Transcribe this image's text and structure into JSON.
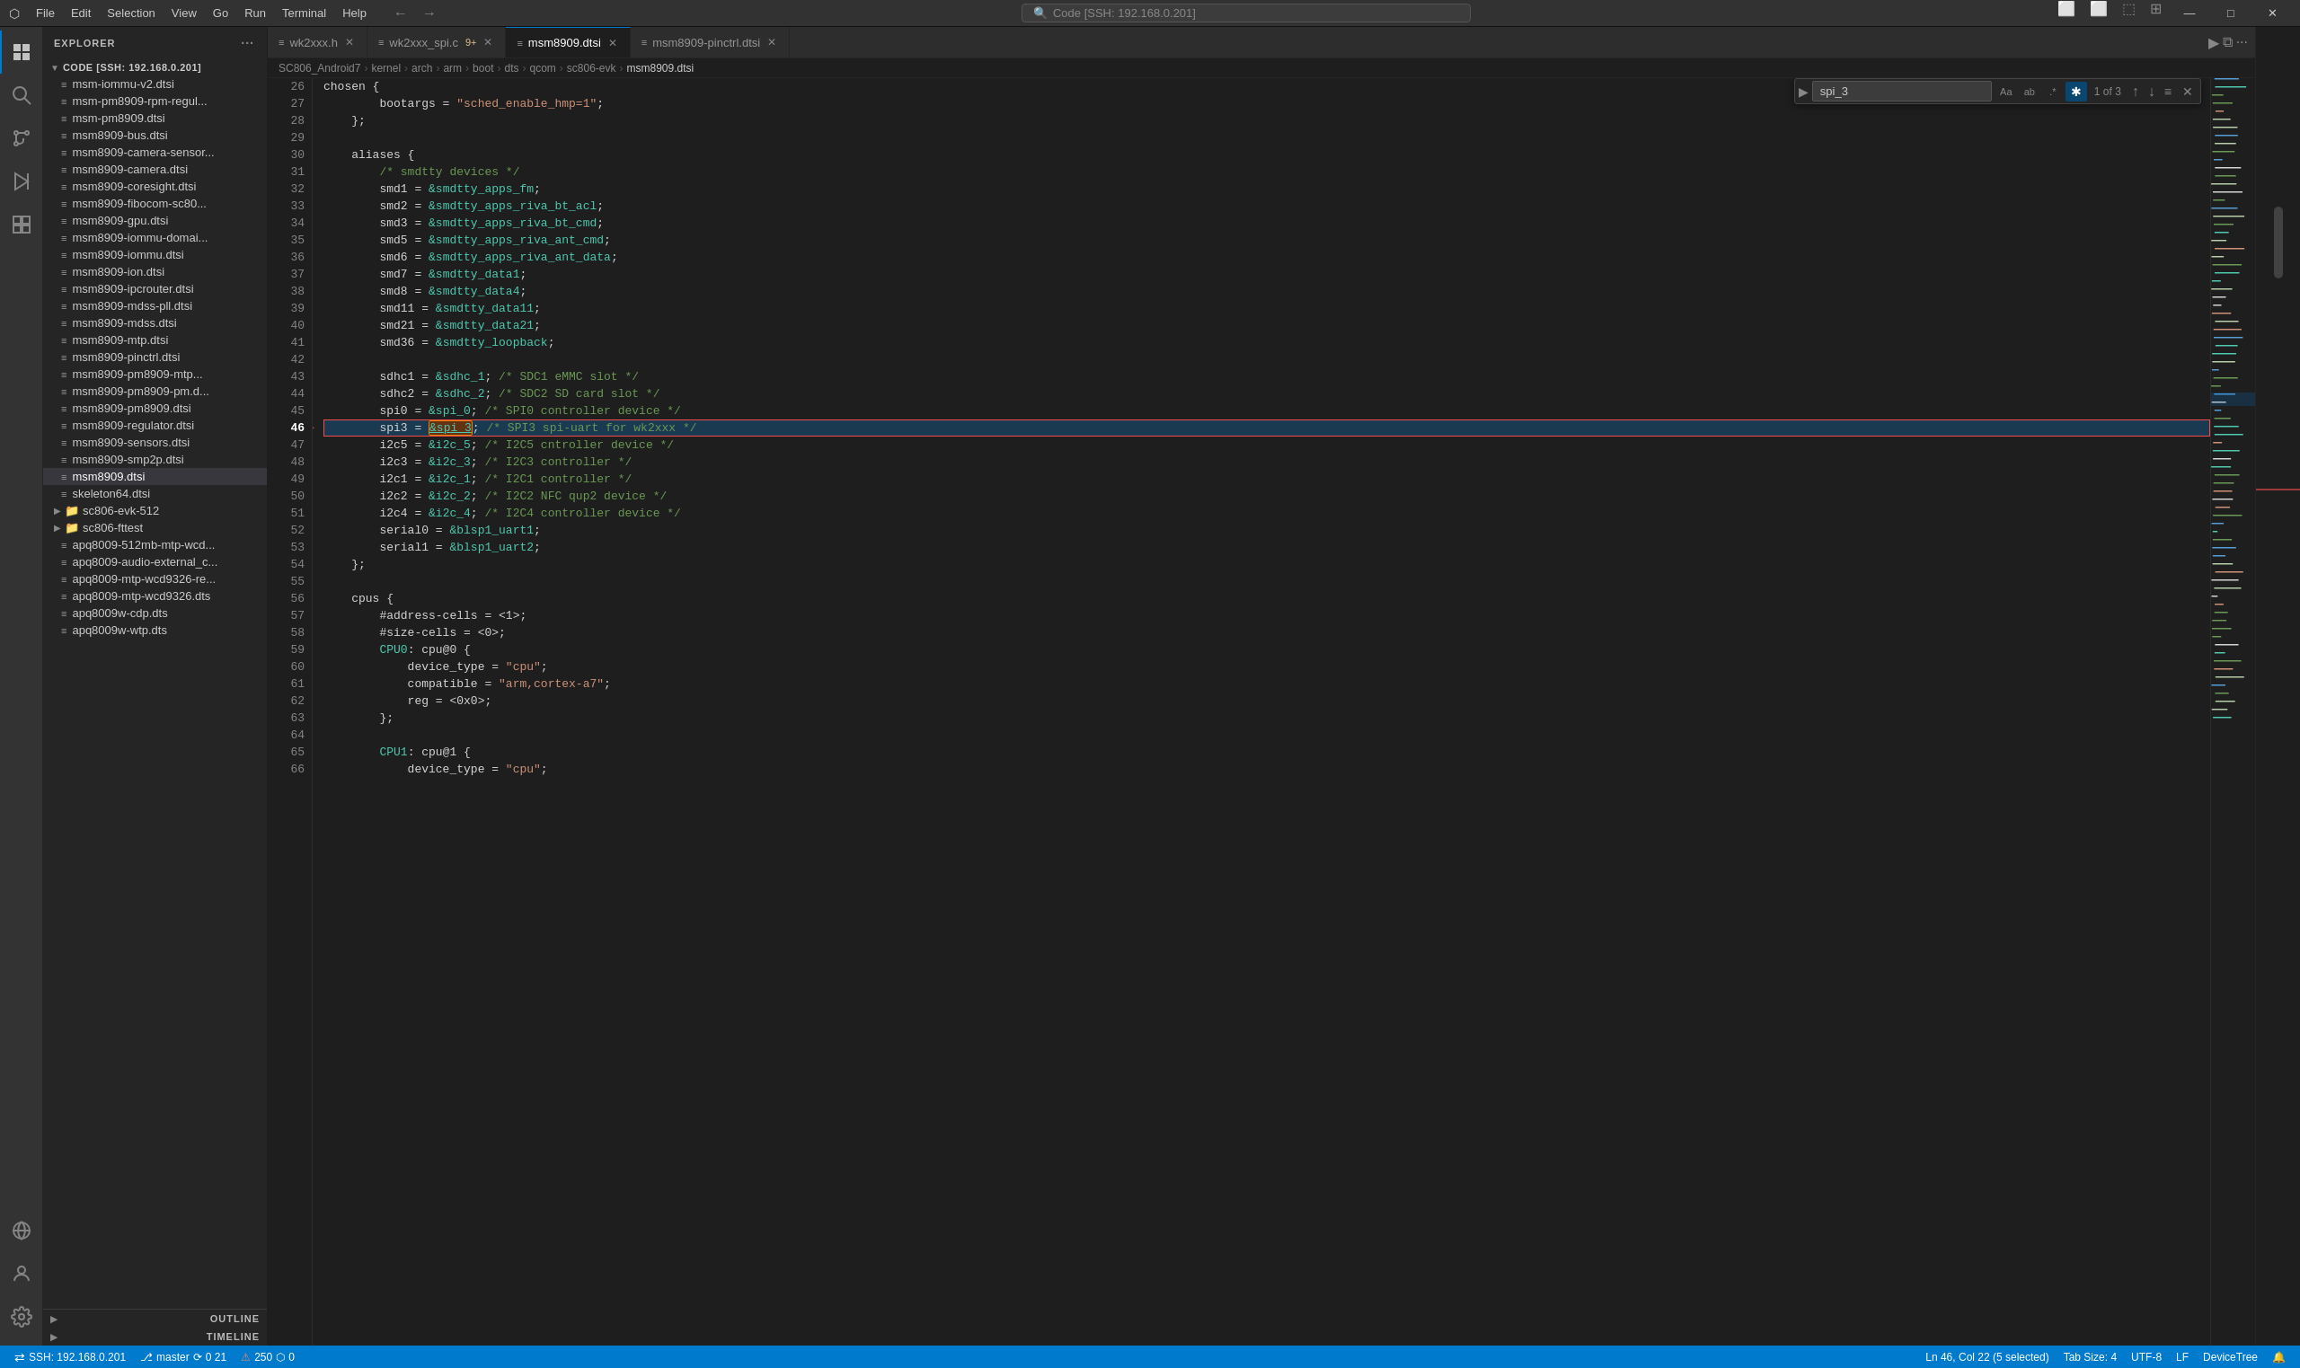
{
  "titlebar": {
    "icon": "⬡",
    "menu": [
      "File",
      "Edit",
      "Selection",
      "View",
      "Go",
      "Run",
      "Terminal",
      "Help"
    ],
    "search_placeholder": "Code [SSH: 192.168.0.201]",
    "window_controls": [
      "─",
      "□",
      "✕"
    ]
  },
  "sidebar": {
    "title": "EXPLORER",
    "more_icon": "···",
    "root": {
      "label": "CODE [SSH: 192.168.0.201]",
      "expanded": true
    },
    "files": [
      "msm-iommu-v2.dtsi",
      "msm-pm8909-rpm-regul...",
      "msm-pm8909.dtsi",
      "msm8909-bus.dtsi",
      "msm8909-camera-sensor...",
      "msm8909-camera.dtsi",
      "msm8909-coresight.dtsi",
      "msm8909-fibocom-sc80...",
      "msm8909-gpu.dtsi",
      "msm8909-iommu-domai...",
      "msm8909-iommu.dtsi",
      "msm8909-ion.dtsi",
      "msm8909-ipcrouter.dtsi",
      "msm8909-mdss-pll.dtsi",
      "msm8909-mdss.dtsi",
      "msm8909-mtp.dtsi",
      "msm8909-pinctrl.dtsi",
      "msm8909-pm8909-mtp...",
      "msm8909-pm8909-pm.d...",
      "msm8909-pm8909.dtsi",
      "msm8909-regulator.dtsi",
      "msm8909-sensors.dtsi",
      "msm8909-smp2p.dtsi",
      "msm8909.dtsi",
      "skeleton64.dtsi"
    ],
    "folders": [
      "sc806-evk-512",
      "sc806-fttest"
    ],
    "other_files": [
      "apq8009-512mb-mtp-wcd...",
      "apq8009-audio-external_c...",
      "apq8009-mtp-wcd9326-re...",
      "apq8009-mtp-wcd9326.dts",
      "apq8009w-cdp.dts",
      "apq8009w-wtp.dts"
    ],
    "panels": {
      "outline": "OUTLINE",
      "timeline": "TIMELINE"
    }
  },
  "tabs": [
    {
      "label": "wk2xxx.h",
      "active": false,
      "modified": false,
      "icon": "≡"
    },
    {
      "label": "wk2xxx_spi.c",
      "active": false,
      "modified": true,
      "count": "9+",
      "icon": "≡"
    },
    {
      "label": "msm8909.dtsi",
      "active": true,
      "modified": false,
      "icon": "≡"
    },
    {
      "label": "msm8909-pinctrl.dtsi",
      "active": false,
      "modified": false,
      "icon": "≡"
    }
  ],
  "breadcrumb": [
    "SC806_Android7",
    "kernel",
    "arch",
    "arm",
    "boot",
    "dts",
    "qcom",
    "sc806-evk",
    "msm8909.dtsi"
  ],
  "find_widget": {
    "search_term": "spi_3",
    "count": "1 of 3",
    "options": [
      "Aa",
      "ab",
      ".*"
    ]
  },
  "code": {
    "lines": [
      {
        "num": 26,
        "content": "chosen {",
        "type": "plain"
      },
      {
        "num": 27,
        "content": "\t\tbootargs = \"sched_enable_hmp=1\";",
        "type": "str"
      },
      {
        "num": 28,
        "content": "\t};",
        "type": "plain"
      },
      {
        "num": 29,
        "content": "",
        "type": "plain"
      },
      {
        "num": 30,
        "content": "\taliases {",
        "type": "plain"
      },
      {
        "num": 31,
        "content": "\t\t/* smdtty devices */",
        "type": "comment"
      },
      {
        "num": 32,
        "content": "\t\tsmd1 = &smdtty_apps_fm;",
        "type": "ref"
      },
      {
        "num": 33,
        "content": "\t\tsmd2 = &smdtty_apps_riva_bt_acl;",
        "type": "ref"
      },
      {
        "num": 34,
        "content": "\t\tsmd3 = &smdtty_apps_riva_bt_cmd;",
        "type": "ref"
      },
      {
        "num": 35,
        "content": "\t\tsmd5 = &smdtty_apps_riva_ant_cmd;",
        "type": "ref"
      },
      {
        "num": 36,
        "content": "\t\tsmd6 = &smdtty_apps_riva_ant_data;",
        "type": "ref"
      },
      {
        "num": 37,
        "content": "\t\tsmd7 = &smdtty_data1;",
        "type": "ref"
      },
      {
        "num": 38,
        "content": "\t\tsmd8 = &smdtty_data4;",
        "type": "ref"
      },
      {
        "num": 39,
        "content": "\t\tsmd11 = &smdtty_data11;",
        "type": "ref"
      },
      {
        "num": 40,
        "content": "\t\tsmd21 = &smdtty_data21;",
        "type": "ref"
      },
      {
        "num": 41,
        "content": "\t\tsmd36 = &smdtty_loopback;",
        "type": "ref"
      },
      {
        "num": 42,
        "content": "",
        "type": "plain"
      },
      {
        "num": 43,
        "content": "\t\tsdhc1 = &sdhc_1; /* SDC1 eMMC slot */",
        "type": "ref_comment"
      },
      {
        "num": 44,
        "content": "\t\tsdhc2 = &sdhc_2; /* SDC2 SD card slot */",
        "type": "ref_comment"
      },
      {
        "num": 45,
        "content": "\t\tspi0 = &spi_0; /* SPI0 controller device */",
        "type": "ref_comment"
      },
      {
        "num": 46,
        "content": "\t\tspi3 = &spi_3; /* SPI3 spi-uart for wk2xxx */",
        "type": "highlighted"
      },
      {
        "num": 47,
        "content": "\t\ti2c5 = &i2c_5; /* I2C5 cntroller device */",
        "type": "ref_comment"
      },
      {
        "num": 48,
        "content": "\t\ti2c3 = &i2c_3; /* I2C3 controller */",
        "type": "ref_comment"
      },
      {
        "num": 49,
        "content": "\t\ti2c1 = &i2c_1; /* I2C1 controller */",
        "type": "ref_comment"
      },
      {
        "num": 50,
        "content": "\t\ti2c2 = &i2c_2; /* I2C2 NFC qup2 device */",
        "type": "ref_comment"
      },
      {
        "num": 51,
        "content": "\t\ti2c4 = &i2c_4; /* I2C4 controller device */",
        "type": "ref_comment"
      },
      {
        "num": 52,
        "content": "\t\tserial0 = &blsp1_uart1;",
        "type": "ref"
      },
      {
        "num": 53,
        "content": "\t\tserial1 = &blsp1_uart2;",
        "type": "ref"
      },
      {
        "num": 54,
        "content": "\t};",
        "type": "plain"
      },
      {
        "num": 55,
        "content": "",
        "type": "plain"
      },
      {
        "num": 56,
        "content": "\tcpus {",
        "type": "plain"
      },
      {
        "num": 57,
        "content": "\t\t#address-cells = <1>;",
        "type": "plain"
      },
      {
        "num": 58,
        "content": "\t\t#size-cells = <0>;",
        "type": "plain"
      },
      {
        "num": 59,
        "content": "\t\tCPU0: cpu@0 {",
        "type": "plain"
      },
      {
        "num": 60,
        "content": "\t\t\tdevice_type = \"cpu\";",
        "type": "str"
      },
      {
        "num": 61,
        "content": "\t\t\tcompatible = \"arm,cortex-a7\";",
        "type": "str"
      },
      {
        "num": 62,
        "content": "\t\t\treg = <0x0>;",
        "type": "plain"
      },
      {
        "num": 63,
        "content": "\t\t};",
        "type": "plain"
      },
      {
        "num": 64,
        "content": "",
        "type": "plain"
      },
      {
        "num": 65,
        "content": "\t\tCPU1: cpu@1 {",
        "type": "plain"
      },
      {
        "num": 66,
        "content": "\t\t\tdevice_type = \"cpu\";",
        "type": "str"
      }
    ]
  },
  "statusbar": {
    "ssh": "SSH: 192.168.0.201",
    "branch": "master",
    "sync_icon": "⟳",
    "errors": "0",
    "warnings": "21",
    "info": "250",
    "no_config": "0",
    "position": "Ln 46, Col 22 (5 selected)",
    "tab_size": "Tab Size: 4",
    "encoding": "UTF-8",
    "line_ending": "LF",
    "language": "DeviceTree",
    "notifications": "🔔"
  }
}
